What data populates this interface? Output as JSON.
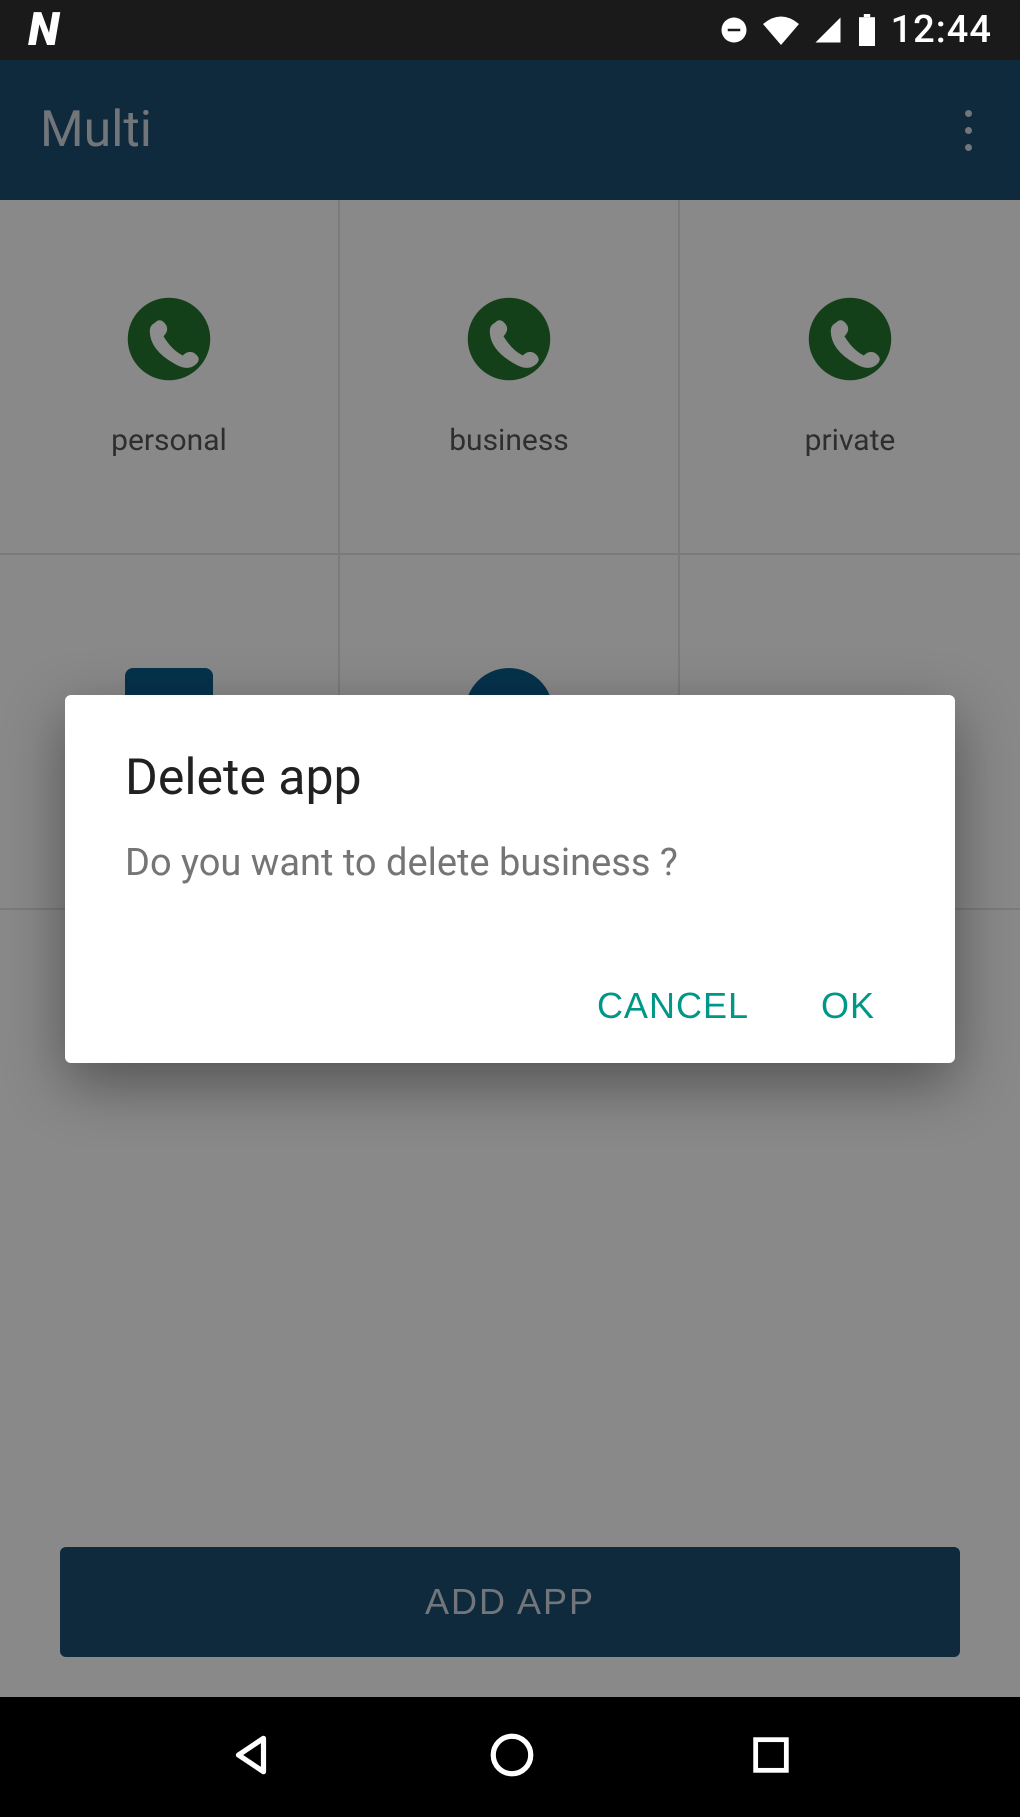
{
  "status": {
    "time": "12:44"
  },
  "appbar": {
    "title": "Multi"
  },
  "grid": {
    "items": [
      {
        "label": "personal"
      },
      {
        "label": "business"
      },
      {
        "label": "private"
      },
      {
        "label": ""
      },
      {
        "label": ""
      }
    ]
  },
  "addButton": {
    "label": "ADD APP"
  },
  "dialog": {
    "title": "Delete app",
    "message": "Do you want to delete business ?",
    "cancel": "CANCEL",
    "ok": "OK"
  }
}
